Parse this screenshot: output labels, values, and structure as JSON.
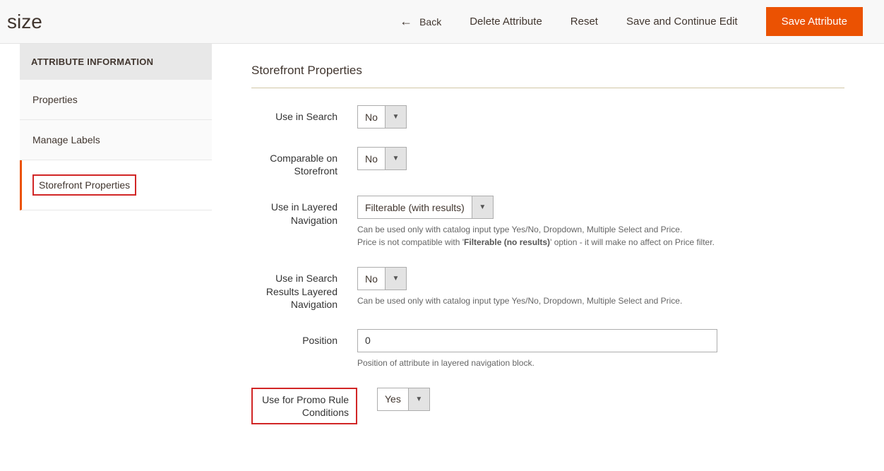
{
  "header": {
    "title": "size",
    "back_label": "Back",
    "delete_label": "Delete Attribute",
    "reset_label": "Reset",
    "save_continue_label": "Save and Continue Edit",
    "save_label": "Save Attribute"
  },
  "sidebar": {
    "section_title": "ATTRIBUTE INFORMATION",
    "items": [
      {
        "label": "Properties"
      },
      {
        "label": "Manage Labels"
      },
      {
        "label": "Storefront Properties"
      }
    ]
  },
  "main": {
    "section_title": "Storefront Properties",
    "fields": {
      "use_in_search": {
        "label": "Use in Search",
        "value": "No"
      },
      "comparable": {
        "label": "Comparable on Storefront",
        "value": "No"
      },
      "layered_nav": {
        "label": "Use in Layered Navigation",
        "value": "Filterable (with results)",
        "note_pre": "Can be used only with catalog input type Yes/No, Dropdown, Multiple Select and Price.",
        "note_mid_a": "Price is not compatible with '",
        "note_bold": "Filterable (no results)",
        "note_mid_b": "' option - it will make no affect on Price filter."
      },
      "search_layered_nav": {
        "label": "Use in Search Results Layered Navigation",
        "value": "No",
        "note": "Can be used only with catalog input type Yes/No, Dropdown, Multiple Select and Price."
      },
      "position": {
        "label": "Position",
        "value": "0",
        "note": "Position of attribute in layered navigation block."
      },
      "promo_rule": {
        "label": "Use for Promo Rule Conditions",
        "value": "Yes"
      }
    }
  }
}
